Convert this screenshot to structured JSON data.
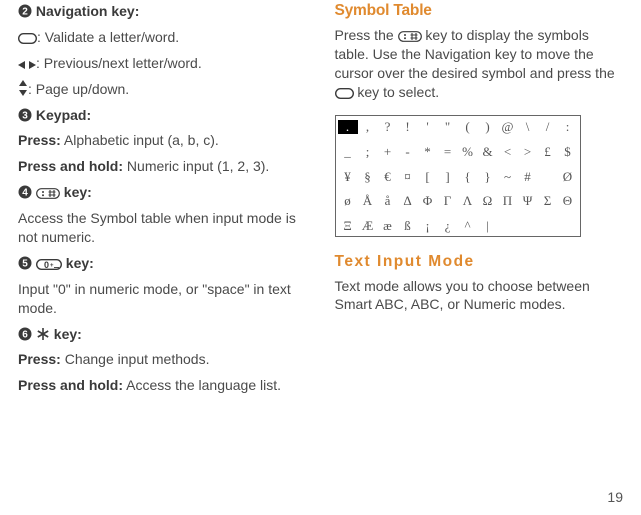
{
  "left": {
    "item2head": "Navigation key:",
    "nav_validate": ": Validate a letter/word.",
    "nav_prevnext": ": Previous/next letter/word.",
    "nav_page": ": Page up/down.",
    "item3head": "Keypad:",
    "keypad_press_lbl": "Press:",
    "keypad_press_txt": " Alphabetic input (a, b, c).",
    "keypad_hold_lbl": "Press and hold:",
    "keypad_hold_txt": " Numeric input (1, 2, 3).",
    "item4head": " key:",
    "item4body": "Access the Symbol table when input mode is not numeric.",
    "item5head": " key:",
    "item5body": "Input \"0\" in numeric mode, or \"space\" in text mode.",
    "item6head": " key:",
    "item6press_lbl": "Press:",
    "item6press_txt": " Change input methods.",
    "item6hold_lbl": "Press and hold:",
    "item6hold_txt": " Access the language list."
  },
  "right": {
    "symtitle": "Symbol Table",
    "sympara_a": "Press the ",
    "sympara_b": " key to display the symbols table. Use the Navigation key to move the cursor over the desired symbol and press the ",
    "sympara_c": " key to select.",
    "rows": [
      [
        ".",
        ",",
        "?",
        "!",
        "'",
        "\"",
        "(",
        ")",
        "@",
        "\\",
        "/",
        ":"
      ],
      [
        "_",
        ";",
        "+",
        "-",
        "*",
        "=",
        "%",
        "&",
        "<",
        ">",
        "£",
        "$"
      ],
      [
        "¥",
        "§",
        "€",
        "¤",
        "[",
        "]",
        "{",
        "}",
        "~",
        "#",
        "",
        "Ø"
      ],
      [
        "ø",
        "Å",
        "å",
        "Δ",
        "Φ",
        "Γ",
        "Λ",
        "Ω",
        "Π",
        "Ψ",
        "Σ",
        "Θ"
      ],
      [
        "Ξ",
        "Æ",
        "æ",
        "ß",
        "¡",
        "¿",
        "^",
        "|",
        "",
        "",
        "",
        ""
      ]
    ],
    "modetitle": "Text Input Mode",
    "modepara": "Text mode allows you to choose between Smart ABC, ABC, or Numeric modes.",
    "pagenum": "19"
  }
}
